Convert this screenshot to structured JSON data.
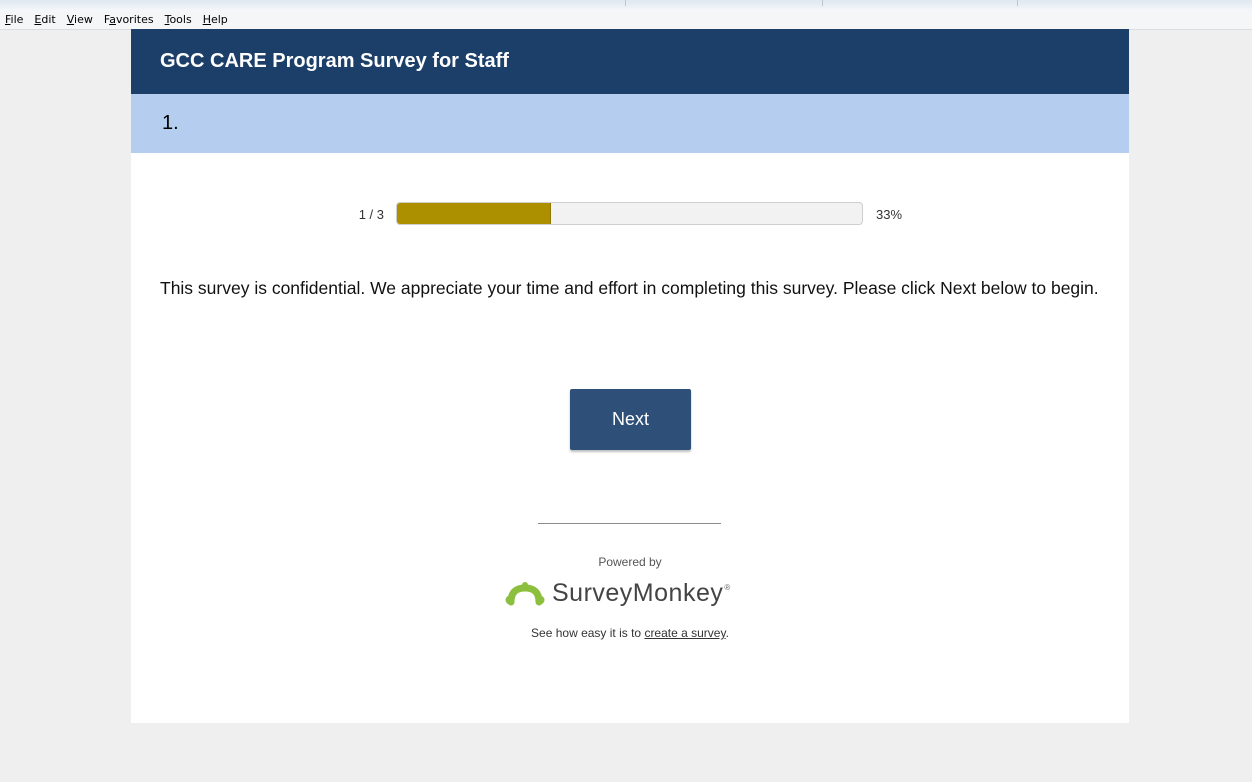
{
  "menu": {
    "items": [
      {
        "key": "F",
        "rest": "ile"
      },
      {
        "key": "E",
        "rest": "dit"
      },
      {
        "key": "V",
        "rest": "iew"
      },
      {
        "pre": "F",
        "key": "a",
        "rest": "vorites"
      },
      {
        "key": "T",
        "rest": "ools"
      },
      {
        "key": "H",
        "rest": "elp"
      }
    ]
  },
  "survey": {
    "title": "GCC CARE Program Survey for Staff",
    "page_title": "1.",
    "progress": {
      "count_label": "1 / 3",
      "percent_label": "33%",
      "fraction": 0.33
    },
    "intro_text": "This survey is confidential. We appreciate your time and effort in completing this survey. Please click Next below to begin.",
    "next_label": "Next"
  },
  "footer": {
    "powered_by": "Powered by",
    "brand": "SurveyMonkey",
    "trademark": "®",
    "easy_prefix": "See how easy it is to ",
    "easy_link": "create a survey",
    "easy_suffix": "."
  },
  "colors": {
    "header_bg": "#1c3f6a",
    "pagebar_bg": "#b5cef0",
    "progress_fill": "#ad9000",
    "button_bg": "#2d4f78",
    "logo_green": "#8dbf3f"
  },
  "icons": {
    "logo": "surveymonkey-monkey-icon"
  }
}
